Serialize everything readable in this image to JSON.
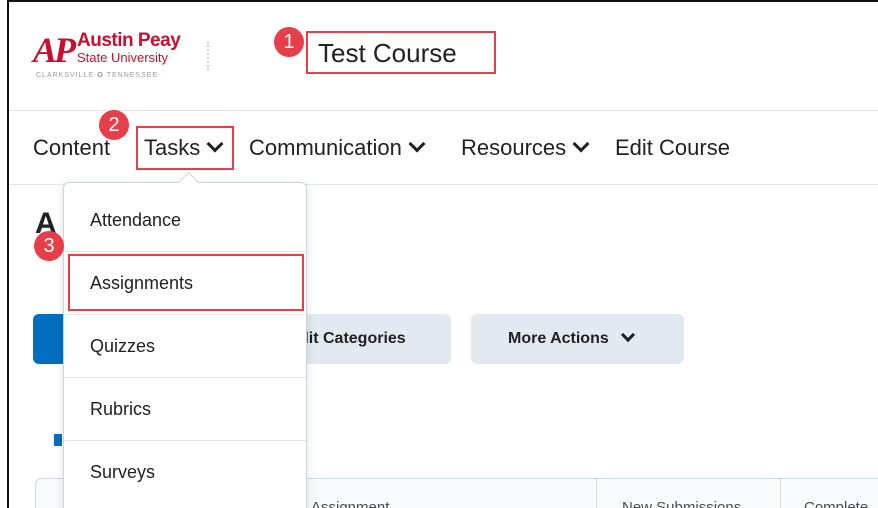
{
  "logo": {
    "mark": "AP",
    "name": "Austin Peay",
    "sub": "State University",
    "tag": "CLARKSVILLE ✪ TENNESSEE"
  },
  "course_title": "Test Course",
  "steps": [
    "1",
    "2",
    "3"
  ],
  "nav": {
    "content": "Content",
    "tasks": "Tasks",
    "communication": "Communication",
    "resources": "Resources",
    "edit_course": "Edit Course"
  },
  "page": {
    "heading_partial": "A",
    "edit_categories": "dit Categories",
    "more_actions": "More Actions",
    "table_headers": [
      "Assignment",
      "New Submissions",
      "Complete"
    ]
  },
  "dropdown": {
    "items": [
      "Attendance",
      "Assignments",
      "Quizzes",
      "Rubrics",
      "Surveys"
    ]
  },
  "colors": {
    "highlight": "#e63f4a",
    "primary": "#006fbf",
    "secondary_button": "#e3e9f1"
  }
}
